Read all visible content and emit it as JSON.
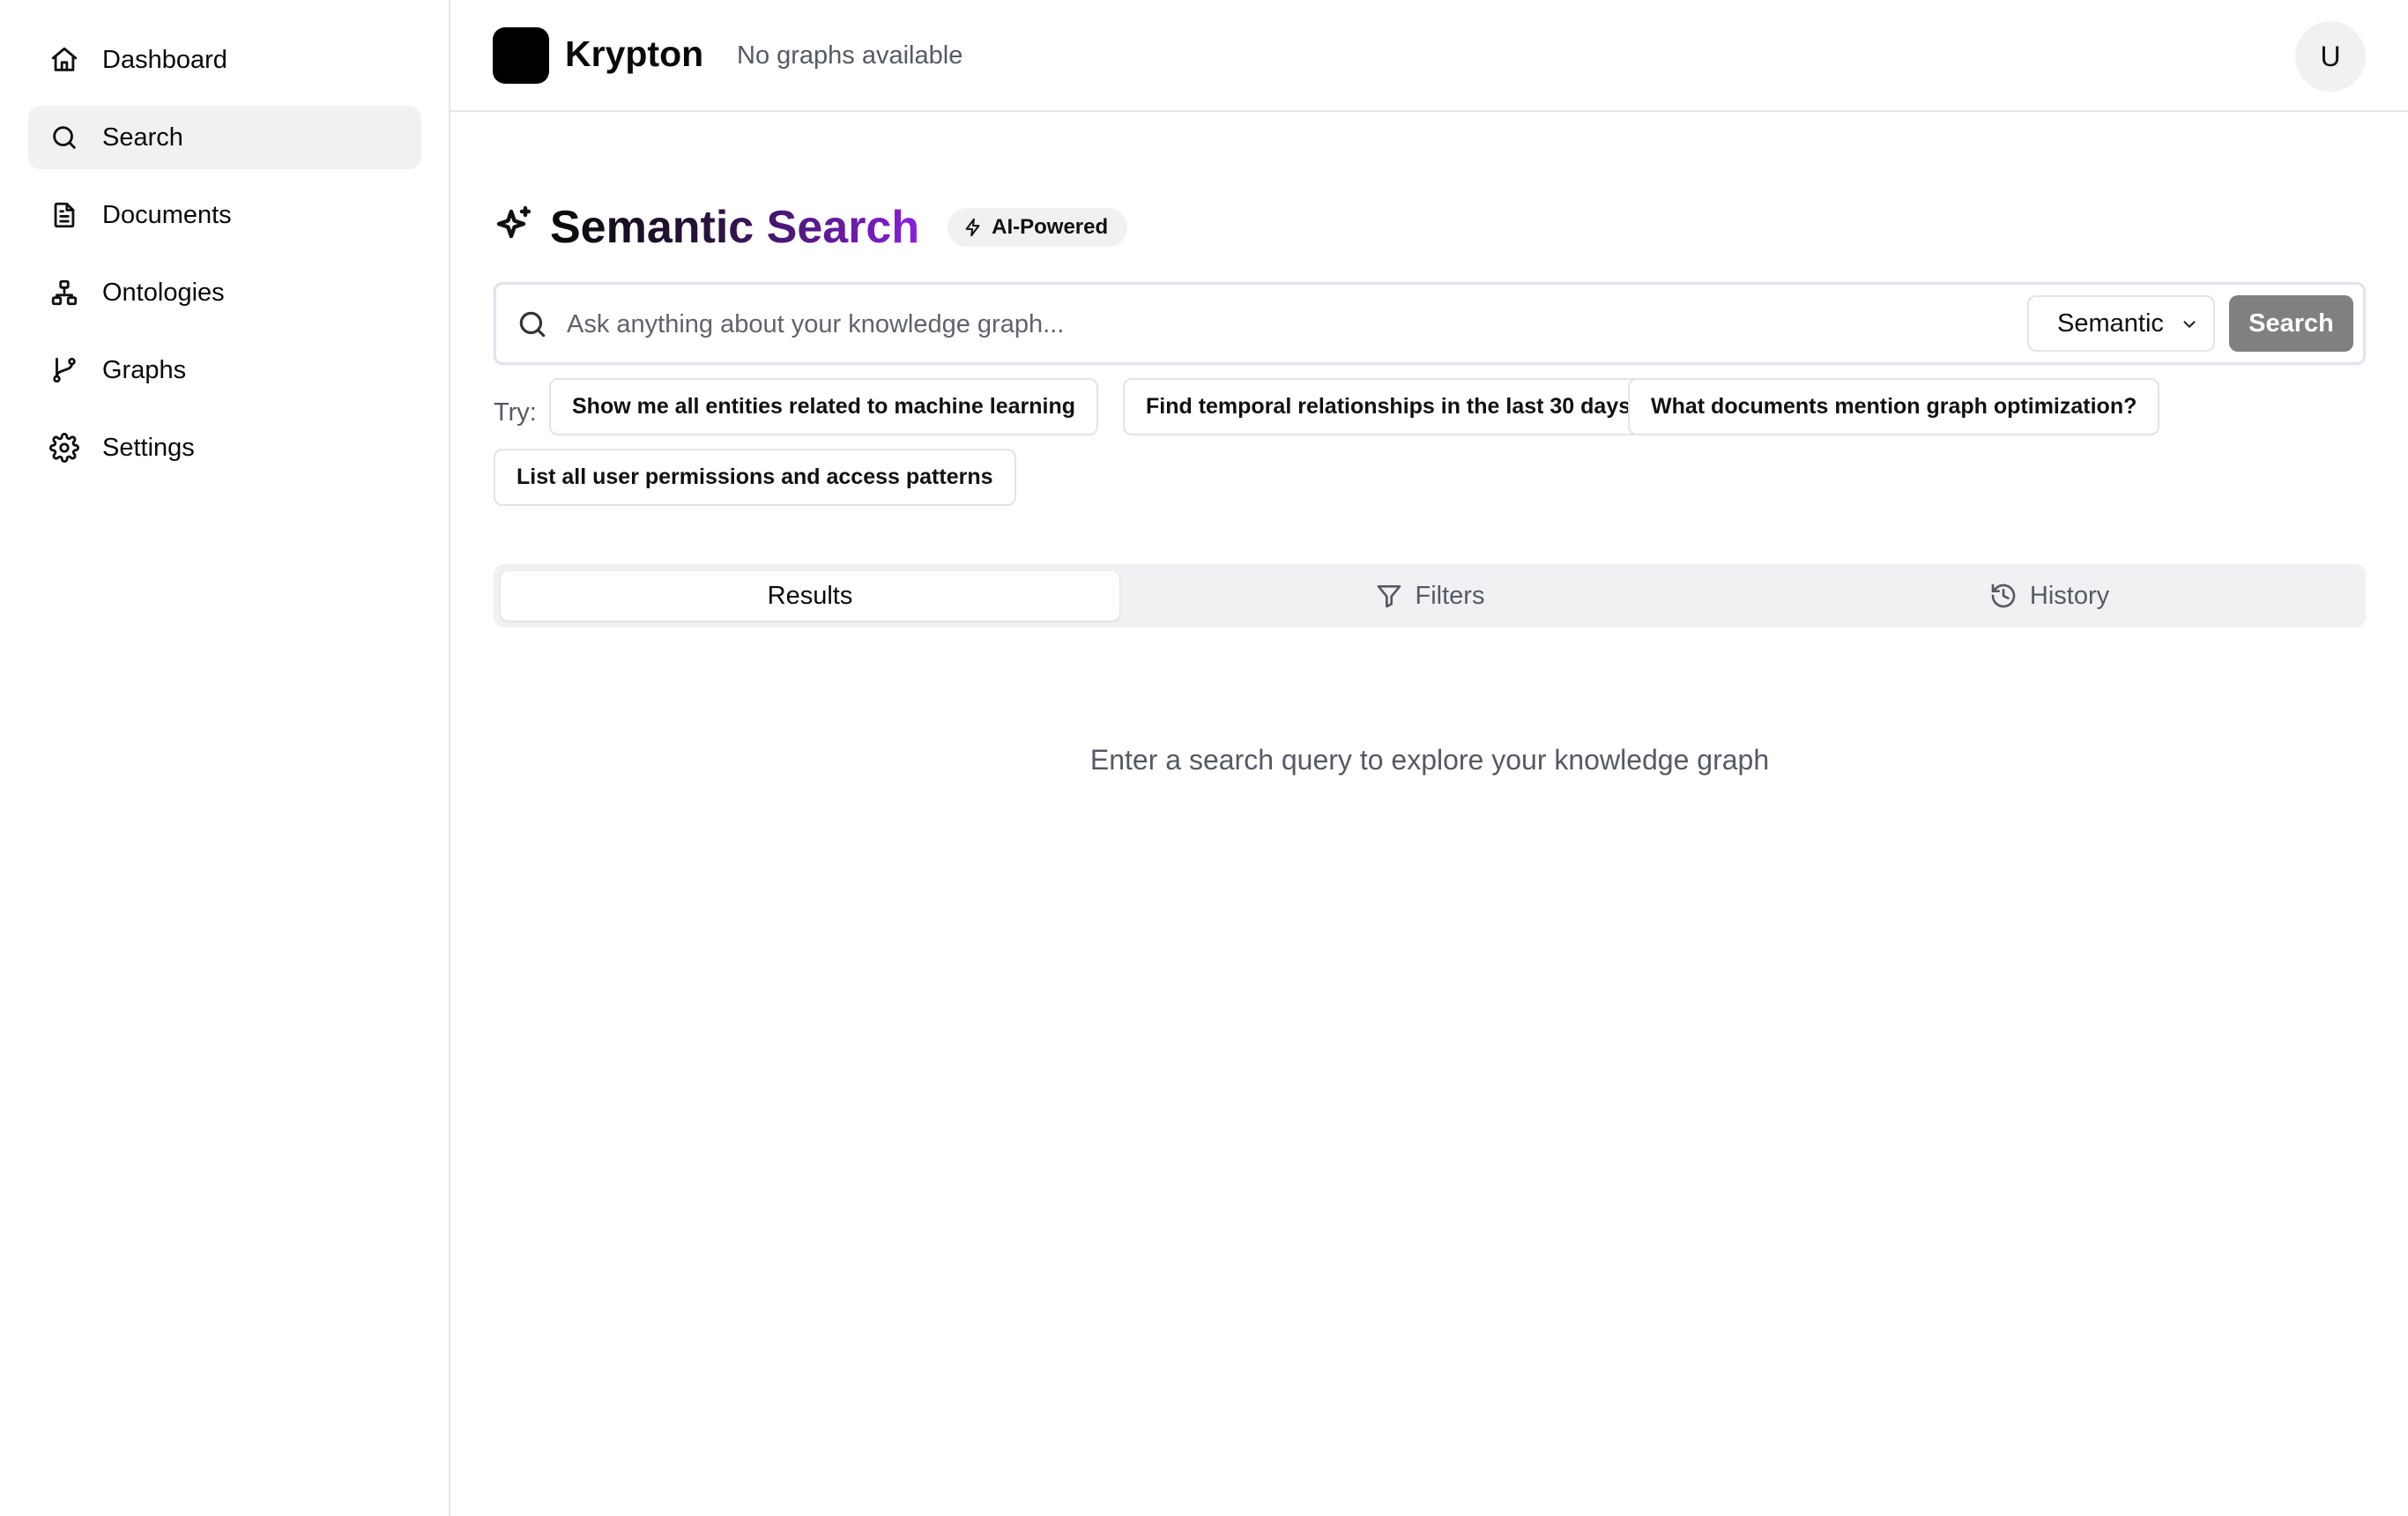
{
  "sidebar": {
    "items": [
      {
        "label": "Dashboard",
        "icon": "home-icon"
      },
      {
        "label": "Search",
        "icon": "search-icon",
        "active": true
      },
      {
        "label": "Documents",
        "icon": "document-icon"
      },
      {
        "label": "Ontologies",
        "icon": "network-icon"
      },
      {
        "label": "Graphs",
        "icon": "git-branch-icon"
      },
      {
        "label": "Settings",
        "icon": "gear-icon"
      }
    ]
  },
  "header": {
    "app_name": "Krypton",
    "graph_status": "No graphs available",
    "avatar_initial": "U"
  },
  "main": {
    "title_part1": "Semantic",
    "title_part2": "Search",
    "badge": "AI-Powered",
    "search": {
      "placeholder": "Ask anything about your knowledge graph...",
      "value": "",
      "mode": "Semantic",
      "button_label": "Search"
    },
    "try_label": "Try:",
    "suggestions": [
      "Show me all entities related to machine learning",
      "Find temporal relationships in the last 30 days",
      "What documents mention graph optimization?",
      "List all user permissions and access patterns"
    ],
    "tabs": [
      {
        "label": "Results",
        "active": true
      },
      {
        "label": "Filters",
        "icon": "filter-icon"
      },
      {
        "label": "History",
        "icon": "history-icon"
      }
    ],
    "empty_state": "Enter a search query to explore your knowledge graph"
  },
  "colors": {
    "accent_purple": "#8a1fe0",
    "search_button": "#808080",
    "active_nav_bg": "#f1f1f4"
  }
}
